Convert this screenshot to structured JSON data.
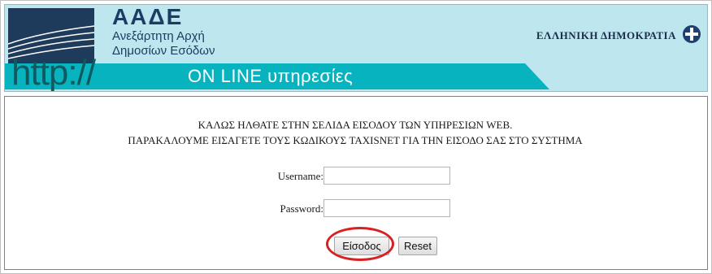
{
  "header": {
    "brand_title": "ΑΑΔΕ",
    "brand_line1": "Ανεξάρτητη Αρχή",
    "brand_line2": "Δημοσίων Εσόδων",
    "republic": "ΕΛΛΗΝΙΚΗ ΔΗΜΟΚΡΑΤΙΑ",
    "http_text": "http://",
    "online_text": "ON LINE υπηρεσίες"
  },
  "main": {
    "welcome_line1": "ΚΑΛΩΣ ΗΛΘΑΤΕ ΣΤΗΝ ΣΕΛΙΔΑ ΕΙΣΟΔΟΥ ΤΩΝ ΥΠΗΡΕΣΙΩΝ WEB.",
    "welcome_line2": "ΠΑΡΑΚΑΛΟΥΜΕ ΕΙΣΑΓΕΤΕ ΤΟΥΣ ΚΩΔΙΚΟΥΣ TAXISNET ΓΙΑ ΤΗΝ ΕΙΣΟΔΟ ΣΑΣ ΣΤΟ ΣΥΣΤΗΜΑ"
  },
  "form": {
    "username_label": "Username:",
    "username_value": "",
    "password_label": "Password:",
    "password_value": "",
    "login_button": "Είσοδος",
    "reset_button": "Reset"
  },
  "colors": {
    "header_bg": "#bde6ee",
    "brand_navy": "#1c3d63",
    "teal_bar": "#08b3c0",
    "highlight_red": "#d62222"
  }
}
